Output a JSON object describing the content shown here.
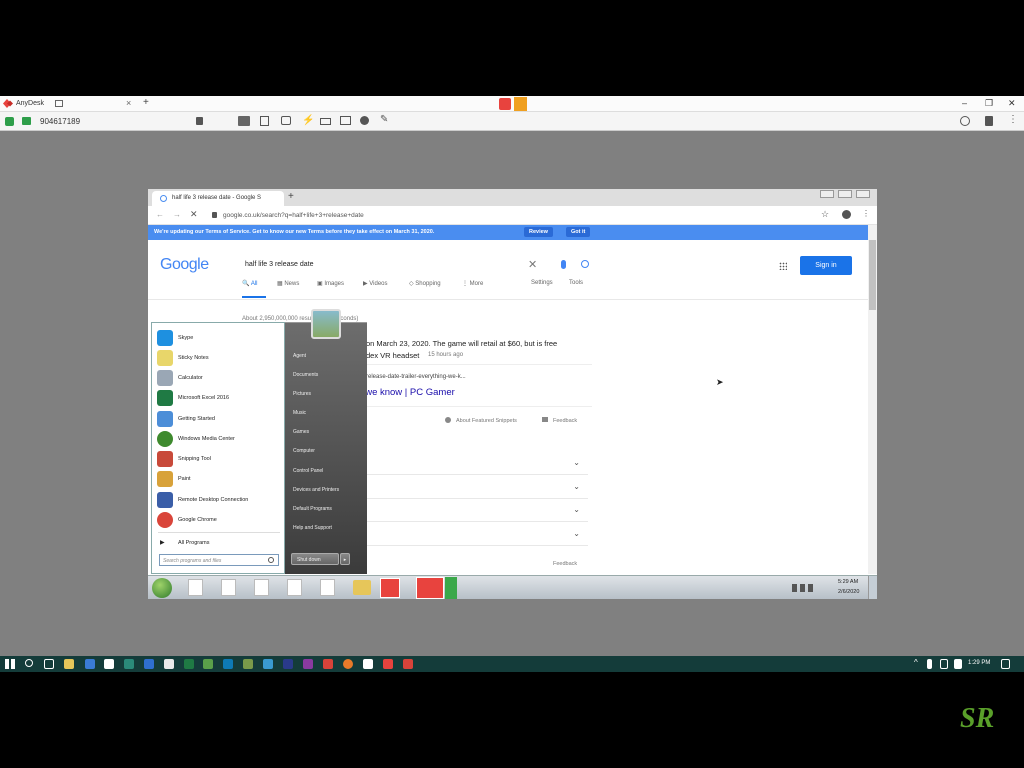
{
  "anydesk": {
    "app_name": "AnyDesk",
    "session_id": "904617189",
    "window_controls": [
      "–",
      "❐",
      "✕"
    ],
    "new_tab": "+",
    "close_tab": "×"
  },
  "chrome": {
    "tab_title": "half life 3 release date - Google S",
    "new_tab": "+",
    "url": "google.co.uk/search?q=half+life+3+release+date",
    "tos_text": "We're updating our Terms of Service. Get to know our new Terms before they take effect on March 31, 2020.",
    "tos_review": "Review",
    "tos_got_it": "Got it"
  },
  "search": {
    "logo": "Google",
    "query": "half life 3 release date",
    "sign_in": "Sign in",
    "tabs": [
      "All",
      "News",
      "Images",
      "Videos",
      "Shopping",
      "More"
    ],
    "settings": "Settings",
    "tools": "Tools",
    "result_stats": "About 2,950,000,000 results (0.77 seconds)",
    "snippet_line1": "on March 23, 2020. The game will retail at $60, but is free",
    "snippet_line2": "dex VR headset",
    "snippet_age": "15 hours ago",
    "snippet_url": "release-date-trailer-everything-we-k...",
    "snippet_title": "ng we know | PC Gamer",
    "about_snippets": "About Featured Snippets",
    "feedback": "Feedback",
    "feedback_bottom": "Feedback"
  },
  "start_menu": {
    "programs": [
      {
        "label": "Skype",
        "color": "#1e90e0"
      },
      {
        "label": "Sticky Notes",
        "color": "#e8d66a"
      },
      {
        "label": "Calculator",
        "color": "#9aa7b5"
      },
      {
        "label": "Microsoft Excel 2016",
        "color": "#1f7a44"
      },
      {
        "label": "Getting Started",
        "color": "#4c8ed8"
      },
      {
        "label": "Windows Media Center",
        "color": "#3e8a2e"
      },
      {
        "label": "Snipping Tool",
        "color": "#c84a3a"
      },
      {
        "label": "Paint",
        "color": "#d8a23a"
      },
      {
        "label": "Remote Desktop Connection",
        "color": "#3a5ea8"
      },
      {
        "label": "Google Chrome",
        "color": "#d9453a"
      }
    ],
    "all_programs": "All Programs",
    "search_placeholder": "Search programs and files",
    "right_items": [
      "Agent",
      "Documents",
      "Pictures",
      "Music",
      "Games",
      "Computer",
      "Control Panel",
      "Devices and Printers",
      "Default Programs",
      "Help and Support"
    ],
    "shutdown": "Shut down"
  },
  "win7_taskbar": {
    "time": "5:29 AM",
    "date": "2/6/2020"
  },
  "win10_taskbar": {
    "time": "1:29 PM"
  },
  "watermark": "SR"
}
